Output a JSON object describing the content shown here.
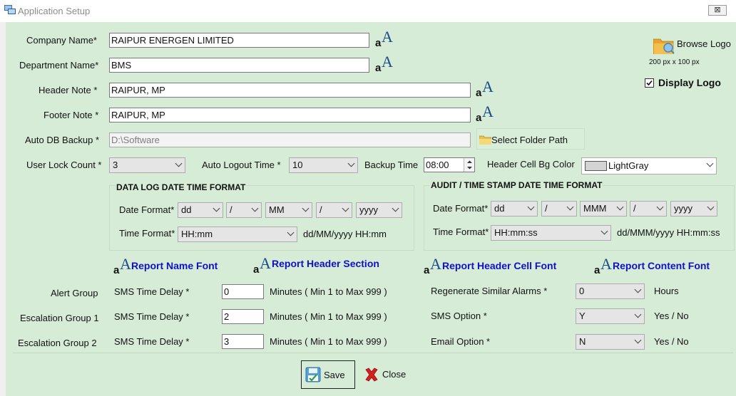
{
  "window": {
    "title": "Application Setup",
    "close_label": "⊠"
  },
  "company": {
    "label": "Company Name*",
    "value": "RAIPUR ENERGEN LIMITED"
  },
  "department": {
    "label": "Department Name*",
    "value": "BMS"
  },
  "header_note": {
    "label": "Header Note *",
    "value": "RAIPUR, MP"
  },
  "footer_note": {
    "label": "Footer Note *",
    "value": "RAIPUR, MP"
  },
  "auto_db_backup": {
    "label": "Auto DB Backup *",
    "value": "D:\\Software",
    "button": "Select Folder Path"
  },
  "logo": {
    "browse_label": "Browse Logo",
    "size_hint": "200 px x 100 px",
    "display_label": "Display Logo",
    "display_checked": true
  },
  "user_lock": {
    "label": "User Lock Count *",
    "value": "3"
  },
  "auto_logout": {
    "label": "Auto Logout Time *",
    "value": "10"
  },
  "backup_time": {
    "label": "Backup Time",
    "value": "08:00"
  },
  "header_cell_bg": {
    "label": "Header Cell Bg Color",
    "value": "LightGray",
    "swatch": "#d3d3d3"
  },
  "data_log": {
    "title": "DATA LOG DATE TIME FORMAT",
    "date_label": "Date Format*",
    "date_parts": [
      "dd",
      "/",
      "MM",
      "/",
      "yyyy"
    ],
    "time_label": "Time Format*",
    "time_value": "HH:mm",
    "preview": "dd/MM/yyyy HH:mm"
  },
  "audit": {
    "title": "AUDIT / TIME STAMP DATE TIME FORMAT",
    "date_label": "Date Format*",
    "date_parts": [
      "dd",
      "/",
      "MMM",
      "/",
      "yyyy"
    ],
    "time_label": "Time Format*",
    "time_value": "HH:mm:ss",
    "preview": "dd/MMM/yyyy HH:mm:ss"
  },
  "fonts": {
    "report_name": "Report Name Font",
    "report_header": "Report Header Section",
    "report_header_cell": "Report Header Cell Font",
    "report_content": "Report Content Font"
  },
  "groups": [
    {
      "name": "Alert Group",
      "sms_label": "SMS Time Delay *",
      "value": "0",
      "hint": "Minutes ( Min 1 to Max 999 )"
    },
    {
      "name": "Escalation Group 1",
      "sms_label": "SMS Time Delay *",
      "value": "2",
      "hint": "Minutes ( Min 1 to Max 999 )"
    },
    {
      "name": "Escalation Group 2",
      "sms_label": "SMS Time Delay *",
      "value": "3",
      "hint": "Minutes ( Min 1 to Max 999 )"
    }
  ],
  "options": [
    {
      "label": "Regenerate Similar Alarms *",
      "value": "0",
      "unit": "Hours"
    },
    {
      "label": "SMS Option *",
      "value": "Y",
      "unit": "Yes / No"
    },
    {
      "label": "Email Option *",
      "value": "N",
      "unit": "Yes / No"
    }
  ],
  "actions": {
    "save": "Save",
    "close": "Close"
  }
}
